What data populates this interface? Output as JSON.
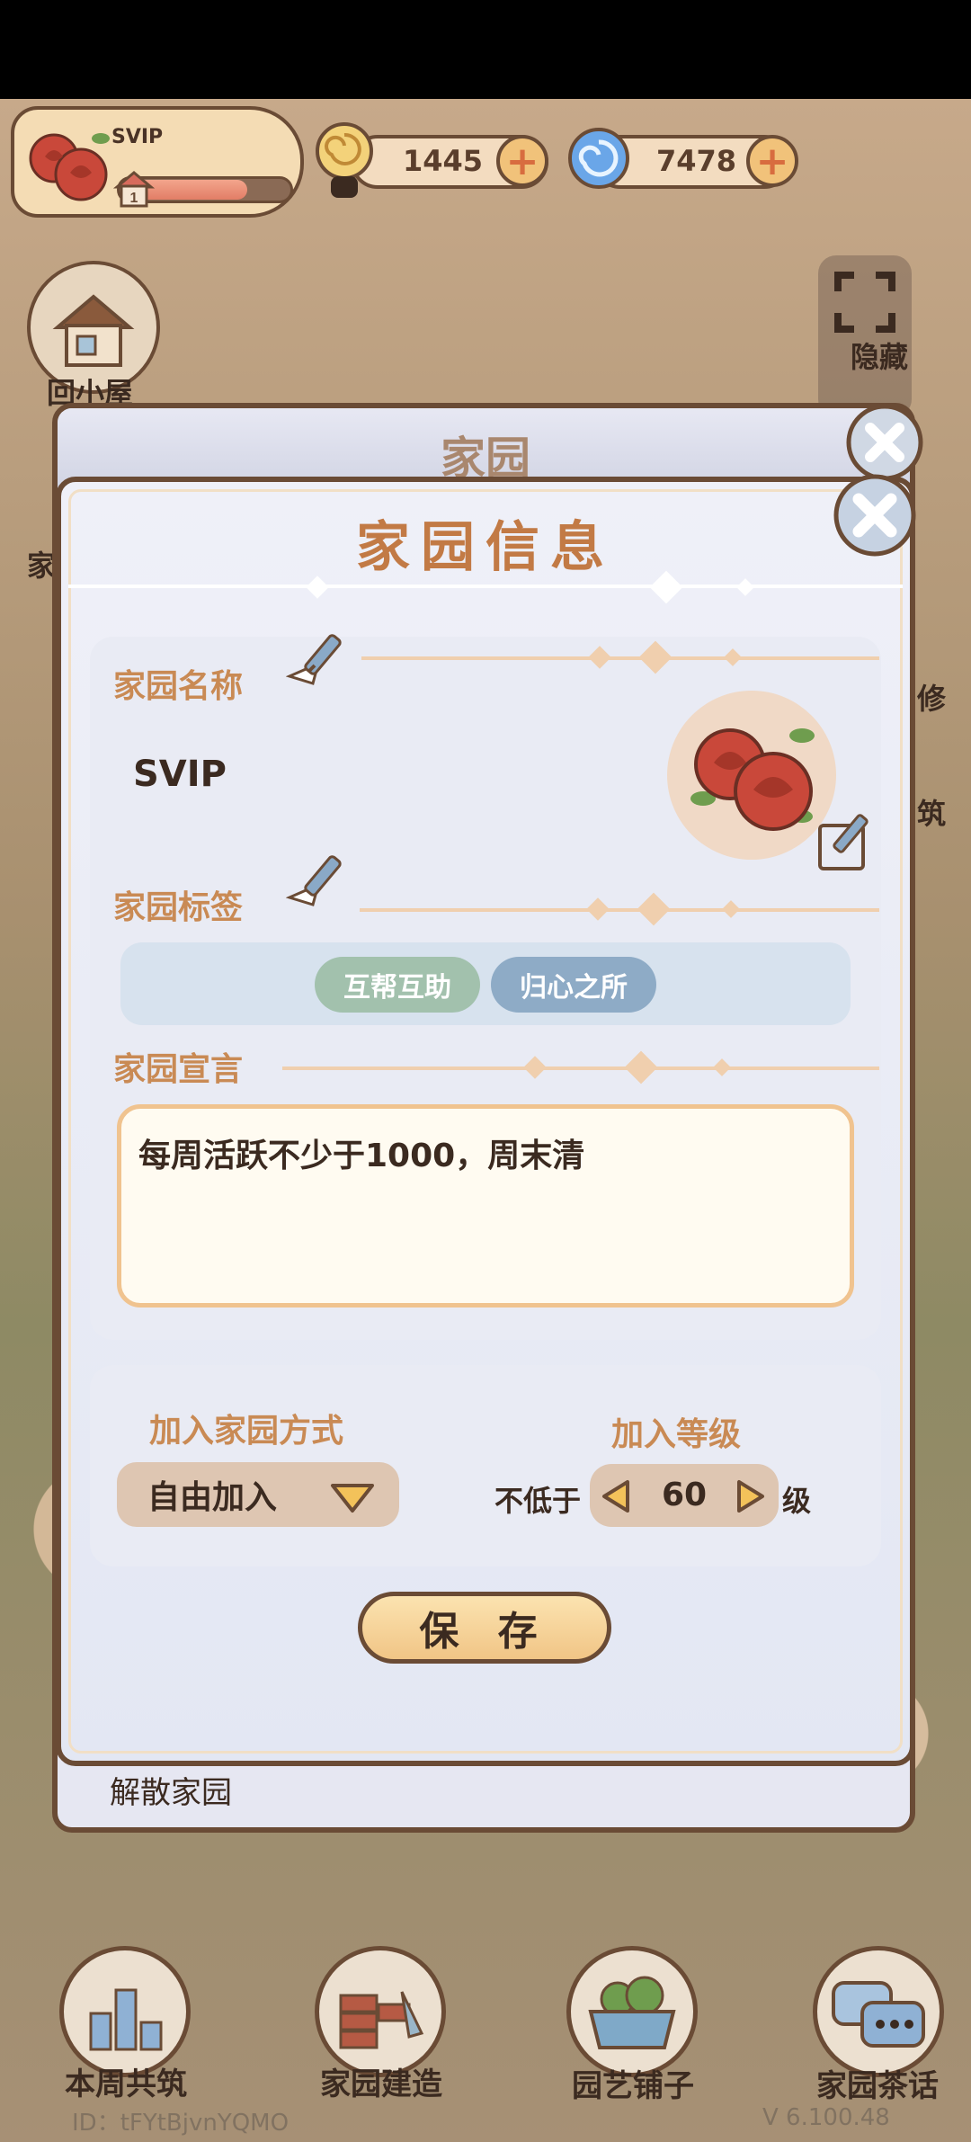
{
  "profile": {
    "name": "SVIP",
    "house_level": "1",
    "level_progress": 0.75
  },
  "currencies": {
    "gold": "1445",
    "gem": "7478"
  },
  "side_buttons": {
    "back_home": "回小屋",
    "home_short": "家",
    "hide": "隐藏",
    "repair": "修",
    "build": "筑"
  },
  "back_dialog": {
    "title": "家园",
    "dissolve": "解散家园"
  },
  "dialog": {
    "title": "家园信息",
    "name_label": "家园名称",
    "name_value": "SVIP",
    "tags_label": "家园标签",
    "tags": [
      "互帮互助",
      "归心之所"
    ],
    "declaration_label": "家园宣言",
    "declaration_text": "每周活跃不少于1000，周末清",
    "join_mode_label": "加入家园方式",
    "join_mode_value": "自由加入",
    "join_level_label": "加入等级",
    "not_below": "不低于",
    "level_value": "60",
    "level_unit": "级",
    "save": "保 存"
  },
  "bottom_nav": [
    "本周共筑",
    "家园建造",
    "园艺铺子",
    "家园茶话"
  ],
  "footer": {
    "id": "ID：tFYtBjvnYQMO",
    "version": "V 6.100.48"
  },
  "colors": {
    "accent_orange": "#c98a54",
    "title_orange": "#c27a45",
    "border_brown": "#6a4b35",
    "tag_green": "#a2c1ad",
    "tag_blue": "#8eabc6"
  }
}
